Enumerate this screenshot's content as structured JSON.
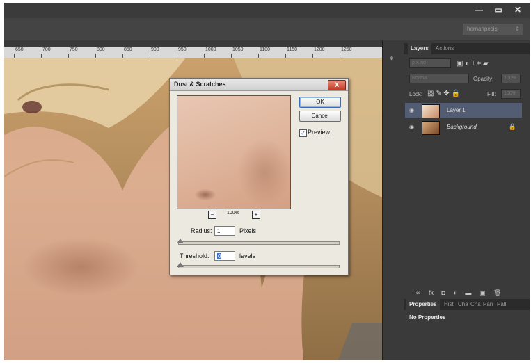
{
  "window_controls": {
    "minimize": "—",
    "restore": "▭",
    "close": "✕"
  },
  "workspace": {
    "name": "hernanpesis",
    "arrow": "⇕"
  },
  "ruler": {
    "ticks": [
      "650",
      "700",
      "750",
      "800",
      "850",
      "900",
      "950",
      "1000",
      "1050",
      "1100",
      "1150",
      "1200",
      "1250"
    ]
  },
  "dialog": {
    "title": "Dust & Scratches",
    "close_label": "X",
    "ok_label": "OK",
    "cancel_label": "Cancel",
    "preview_label": "Preview",
    "preview_checked": "✓",
    "zoom_out": "−",
    "zoom_in": "+",
    "zoom_level": "100%",
    "radius_label": "Radius:",
    "radius_value": "1",
    "radius_unit": "Pixels",
    "threshold_label": "Threshold:",
    "threshold_value": "0",
    "threshold_unit": "levels"
  },
  "layers_panel": {
    "tabs": [
      "Layers",
      "Actions"
    ],
    "filter_label": "Kind",
    "blend_mode": "Normal",
    "opacity_label": "Opacity:",
    "opacity_value": "100%",
    "lock_label": "Lock:",
    "fill_label": "Fill:",
    "fill_value": "100%",
    "layers": [
      {
        "name": "Layer 1"
      },
      {
        "name": "Background"
      }
    ],
    "footer_icons": [
      "∞",
      "fx",
      "◘",
      "◐",
      "▬",
      "▣",
      "🗑"
    ]
  },
  "properties_panel": {
    "tabs": [
      "Properties",
      "Hist",
      "Cha",
      "Cha",
      "Pan",
      "Pall"
    ],
    "content": "No Properties"
  },
  "colors": {
    "accent": "#2f6ec0",
    "layer_selected": "#525c72",
    "panel_bg": "#3a3a3a"
  }
}
